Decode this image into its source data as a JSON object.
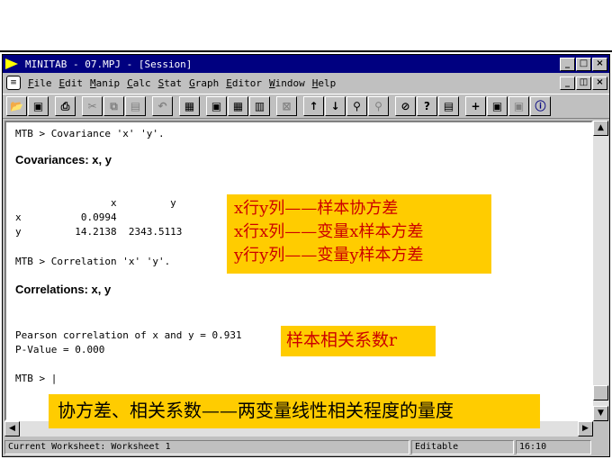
{
  "window": {
    "title": "MINITAB - 07.MPJ - [Session]",
    "minimize": "_",
    "maximize": "□",
    "close": "×",
    "mdi_restore": "◫"
  },
  "menu": [
    {
      "mnemonic": "F",
      "rest": "ile"
    },
    {
      "mnemonic": "E",
      "rest": "dit"
    },
    {
      "mnemonic": "M",
      "rest": "anip"
    },
    {
      "mnemonic": "C",
      "rest": "alc"
    },
    {
      "mnemonic": "S",
      "rest": "tat"
    },
    {
      "mnemonic": "G",
      "rest": "raph"
    },
    {
      "mnemonic": "E",
      "rest": "ditor"
    },
    {
      "mnemonic": "W",
      "rest": "indow"
    },
    {
      "mnemonic": "H",
      "rest": "elp"
    }
  ],
  "toolbar_icons": [
    "open-icon",
    "save-icon",
    "print-icon",
    "cut-icon",
    "copy-icon",
    "paste-icon",
    "undo-icon",
    "edit-last-dialog-icon",
    "session-window-icon",
    "worksheet-icon",
    "project-manager-icon",
    "close-graphs-icon",
    "up-arrow-icon",
    "down-arrow-icon",
    "find-icon",
    "find-next-icon",
    "cancel-icon",
    "help-icon",
    "stat-guide-icon",
    "append-icon",
    "tile-icon",
    "cascade-icon",
    "info-icon"
  ],
  "session": {
    "line1": "MTB > Covariance 'x' 'y'.",
    "cov_heading": "Covariances: x, y",
    "cov_header": "                x         y",
    "cov_row_x": "x          0.0994",
    "cov_row_y": "y         14.2138  2343.5113",
    "line2": "MTB > Correlation 'x' 'y'.",
    "corr_heading": "Correlations: x, y",
    "pearson": "Pearson correlation of x and y = 0.931",
    "pvalue": "P-Value = 0.000",
    "prompt": "MTB > |"
  },
  "annotations": {
    "cov_note_1": "x行y列——样本协方差",
    "cov_note_2": "x行x列——变量x样本方差",
    "cov_note_3": "y行y列——变量y样本方差",
    "corr_note": "样本相关系数r",
    "bottom_note": "协方差、相关系数——两变量线性相关程度的量度"
  },
  "status": {
    "worksheet": "Current Worksheet: Worksheet 1",
    "mode": "Editable",
    "time": "16:10"
  },
  "colors": {
    "titlebar": "#000080",
    "note_bg": "#ffcc00",
    "note_text": "#cc0000"
  }
}
